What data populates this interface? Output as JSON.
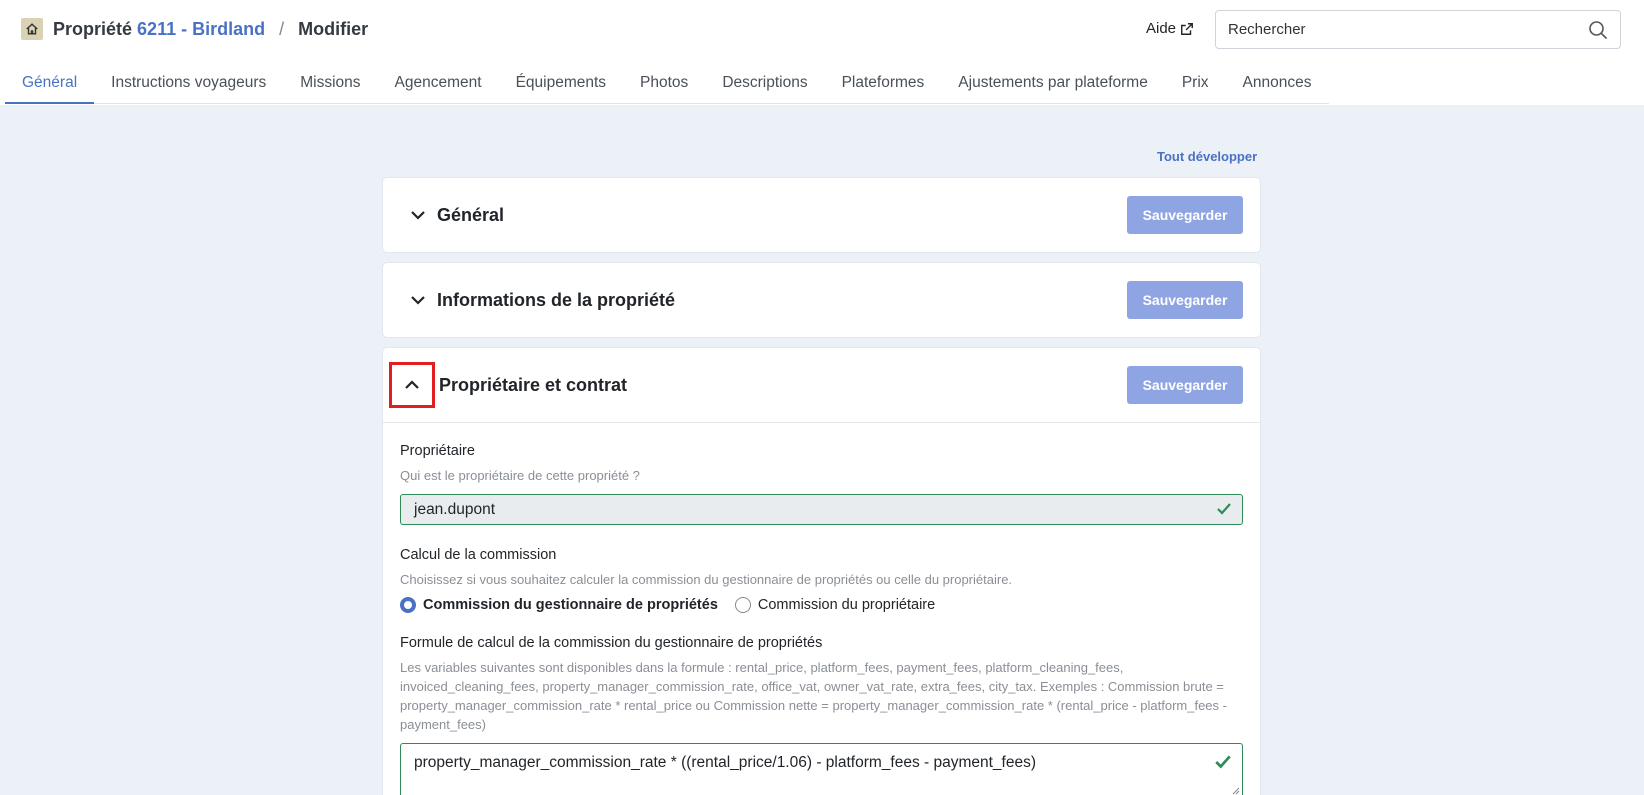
{
  "header": {
    "prefix": "Propriété",
    "property_link": "6211 - Birdland",
    "separator": "/",
    "page": "Modifier",
    "help_label": "Aide",
    "search_placeholder": "Rechercher"
  },
  "tabs": [
    {
      "label": "Général",
      "active": true
    },
    {
      "label": "Instructions voyageurs"
    },
    {
      "label": "Missions"
    },
    {
      "label": "Agencement"
    },
    {
      "label": "Équipements"
    },
    {
      "label": "Photos"
    },
    {
      "label": "Descriptions"
    },
    {
      "label": "Plateformes"
    },
    {
      "label": "Ajustements par plateforme"
    },
    {
      "label": "Prix"
    },
    {
      "label": "Annonces"
    }
  ],
  "expand_all": "Tout développer",
  "save_label": "Sauvegarder",
  "sections": [
    {
      "title": "Général",
      "expanded": false
    },
    {
      "title": "Informations de la propriété",
      "expanded": false
    },
    {
      "title": "Propriétaire et contrat",
      "expanded": true
    }
  ],
  "owner": {
    "label": "Propriétaire",
    "help": "Qui est le propriétaire de cette propriété ?",
    "value": "jean.dupont"
  },
  "commission": {
    "label": "Calcul de la commission",
    "help": "Choisissez si vous souhaitez calculer la commission du gestionnaire de propriétés ou celle du propriétaire.",
    "options": [
      {
        "label": "Commission du gestionnaire de propriétés",
        "selected": true
      },
      {
        "label": "Commission du propriétaire",
        "selected": false
      }
    ]
  },
  "formula": {
    "label": "Formule de calcul de la commission du gestionnaire de propriétés",
    "help": "Les variables suivantes sont disponibles dans la formule : rental_price, platform_fees, payment_fees, platform_cleaning_fees, invoiced_cleaning_fees, property_manager_commission_rate, office_vat, owner_vat_rate, extra_fees, city_tax. Exemples : Commission brute = property_manager_commission_rate * rental_price ou Commission nette = property_manager_commission_rate * (rental_price - platform_fees - payment_fees)",
    "value": "property_manager_commission_rate * ((rental_price/1.06) - platform_fees - payment_fees)"
  },
  "colors": {
    "accent": "#4a72c4",
    "save": "#8fa4e2",
    "valid": "#2e8b57",
    "highlight": "#e02020"
  }
}
